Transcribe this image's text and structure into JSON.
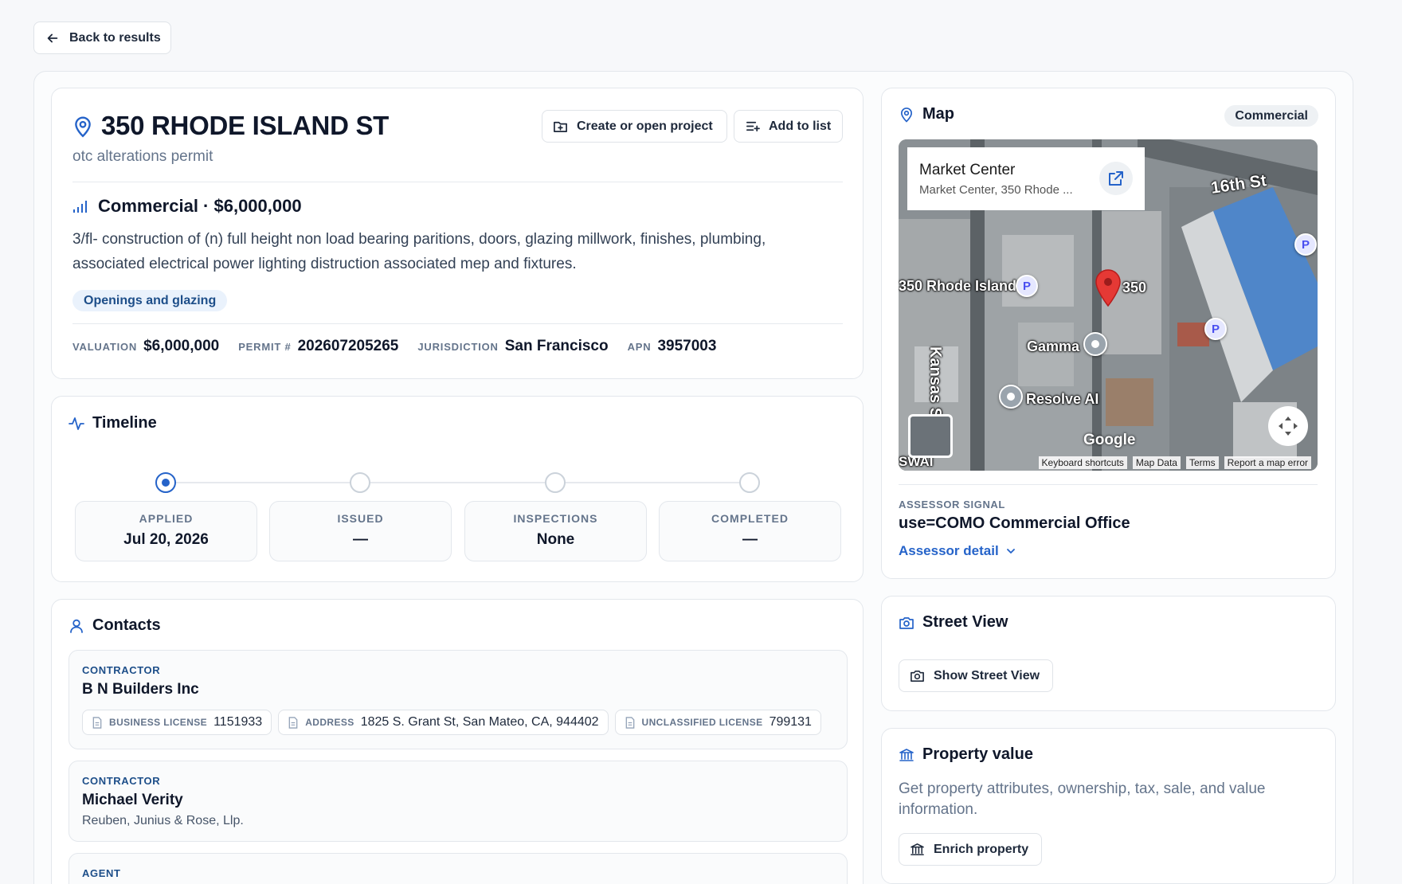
{
  "nav": {
    "back_label": "Back to results"
  },
  "summary": {
    "address": "350 RHODE ISLAND ST",
    "permit_type": "otc alterations permit",
    "create_project_label": "Create or open project",
    "add_to_list_label": "Add to list",
    "classification": "Commercial · $6,000,000",
    "description": "3/fl- construction of (n) full height non load bearing paritions, doors, glazing millwork, finishes, plumbing, associated electrical power lighting distruction associated mep and fixtures.",
    "tag": "Openings and glazing",
    "facts": [
      {
        "label": "VALUATION",
        "value": "$6,000,000"
      },
      {
        "label": "PERMIT #",
        "value": "202607205265"
      },
      {
        "label": "JURISDICTION",
        "value": "San Francisco"
      },
      {
        "label": "APN",
        "value": "3957003"
      }
    ]
  },
  "timeline": {
    "title": "Timeline",
    "steps": [
      {
        "label": "APPLIED",
        "value": "Jul 20, 2026",
        "active": true
      },
      {
        "label": "ISSUED",
        "value": "—",
        "active": false
      },
      {
        "label": "INSPECTIONS",
        "value": "None",
        "active": false
      },
      {
        "label": "COMPLETED",
        "value": "—",
        "active": false
      }
    ]
  },
  "contacts": {
    "title": "Contacts",
    "items": [
      {
        "role": "CONTRACTOR",
        "name": "B N Builders Inc",
        "chips": [
          {
            "label": "BUSINESS LICENSE",
            "value": "1151933"
          },
          {
            "label": "ADDRESS",
            "value": "1825 S. Grant St, San Mateo, CA, 944402"
          },
          {
            "label": "UNCLASSIFIED LICENSE",
            "value": "799131"
          }
        ]
      },
      {
        "role": "CONTRACTOR",
        "name": "Michael Verity",
        "subtitle": "Reuben, Junius & Rose, Llp."
      },
      {
        "role": "AGENT"
      }
    ]
  },
  "map": {
    "title": "Map",
    "badge": "Commercial",
    "place_title": "Market Center",
    "place_subtitle": "Market Center, 350 Rhode ...",
    "labels": {
      "street_16th": "16th St",
      "rhode_island": "350 Rhode Island",
      "num_350": "350",
      "kansas": "Kansas St",
      "gamma": "Gamma",
      "resolve": "Resolve AI",
      "swai": "SWAI",
      "google": "Google"
    },
    "footer": [
      "Keyboard shortcuts",
      "Map Data",
      "Terms",
      "Report a map error"
    ],
    "assessor_label": "ASSESSOR SIGNAL",
    "assessor_value": "use=COMO Commercial Office",
    "assessor_link": "Assessor detail"
  },
  "street_view": {
    "title": "Street View",
    "button_label": "Show Street View"
  },
  "property_value": {
    "title": "Property value",
    "description": "Get property attributes, ownership, tax, sale, and value information.",
    "button_label": "Enrich property"
  },
  "colors": {
    "accent": "#2563c9",
    "tag_bg": "#eaf2fc",
    "tag_text": "#1d4e89"
  }
}
